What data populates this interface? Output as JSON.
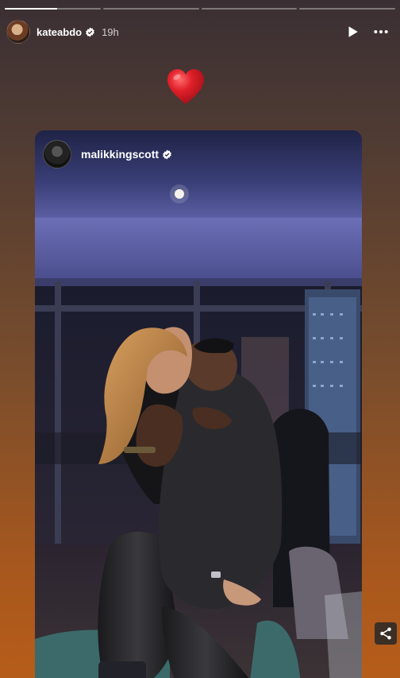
{
  "story": {
    "progress_segments": [
      1,
      0,
      0,
      0
    ],
    "header": {
      "username": "kateabdo",
      "time": "19h",
      "icons": [
        "verified-badge-icon",
        "play-icon",
        "more-options-icon"
      ]
    },
    "sticker": {
      "icon": "red-heart-icon",
      "color": "#e0202a"
    },
    "shared_post": {
      "username": "malikkingscott",
      "icons": [
        "verified-badge-icon"
      ]
    },
    "share_icon": "share-icon"
  }
}
